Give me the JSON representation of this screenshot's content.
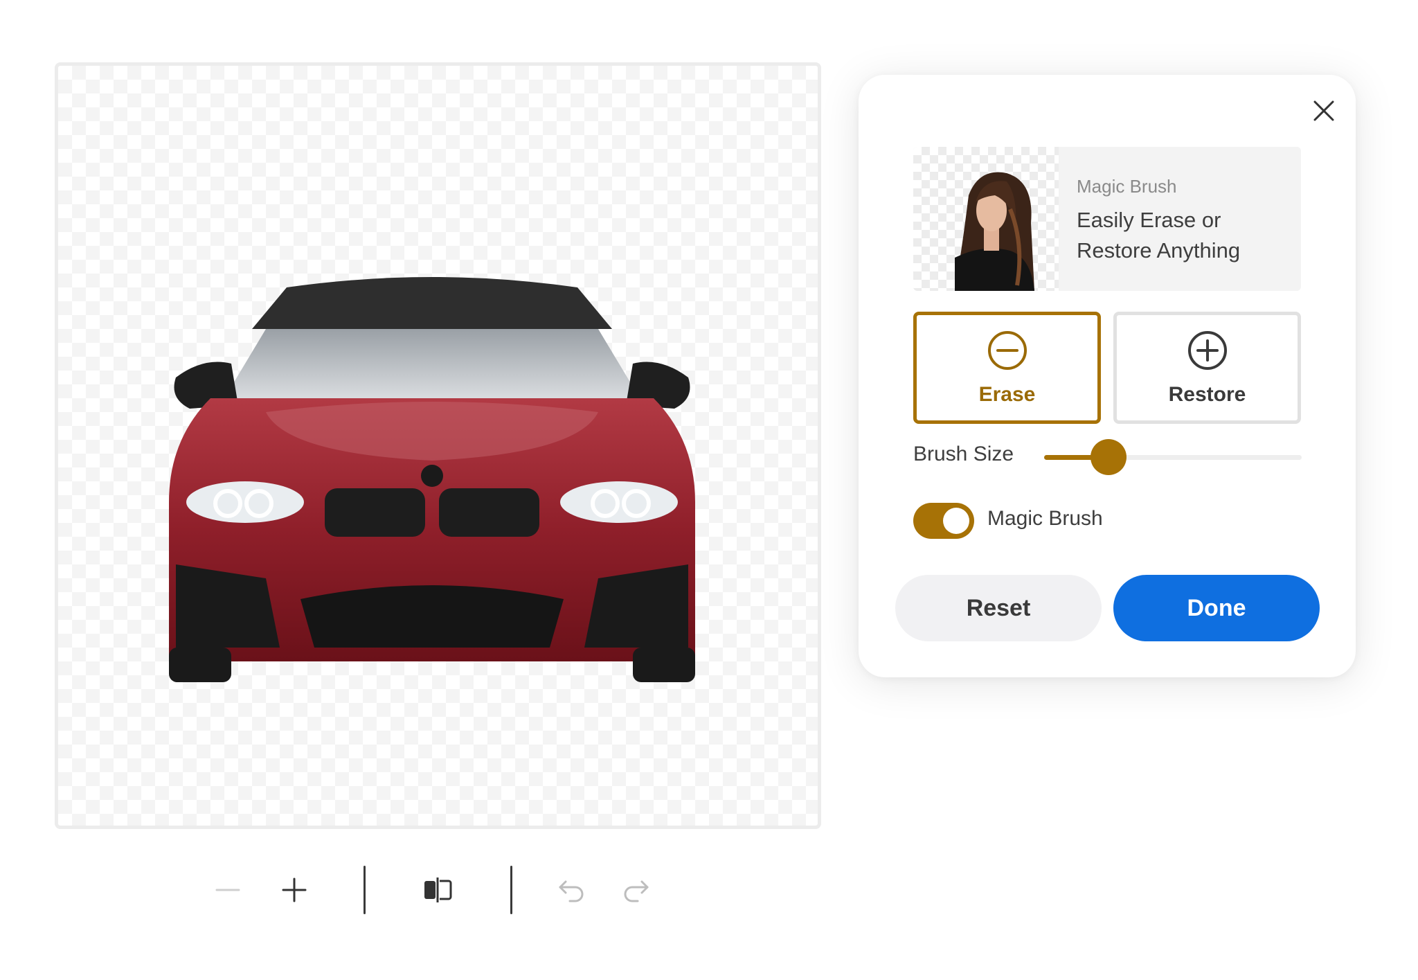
{
  "canvas": {
    "image_icon": "car-cutout"
  },
  "toolbar": {
    "zoom_out_icon": "minus-icon",
    "zoom_in_icon": "plus-icon",
    "compare_icon": "compare-icon",
    "undo_icon": "undo-icon",
    "redo_icon": "redo-icon"
  },
  "panel": {
    "close_icon": "close-icon",
    "promo": {
      "eyebrow": "Magic Brush",
      "title": "Easily Erase or Restore Anything"
    },
    "modes": {
      "erase_label": "Erase",
      "restore_label": "Restore",
      "selected": "erase"
    },
    "brush_size": {
      "label": "Brush Size",
      "value_fraction": 0.25
    },
    "magic_brush": {
      "label": "Magic Brush",
      "enabled": true
    },
    "reset_label": "Reset",
    "done_label": "Done"
  },
  "colors": {
    "accent": "#a77206",
    "primary": "#0f6fe0",
    "neutral_button": "#f1f1f3"
  }
}
